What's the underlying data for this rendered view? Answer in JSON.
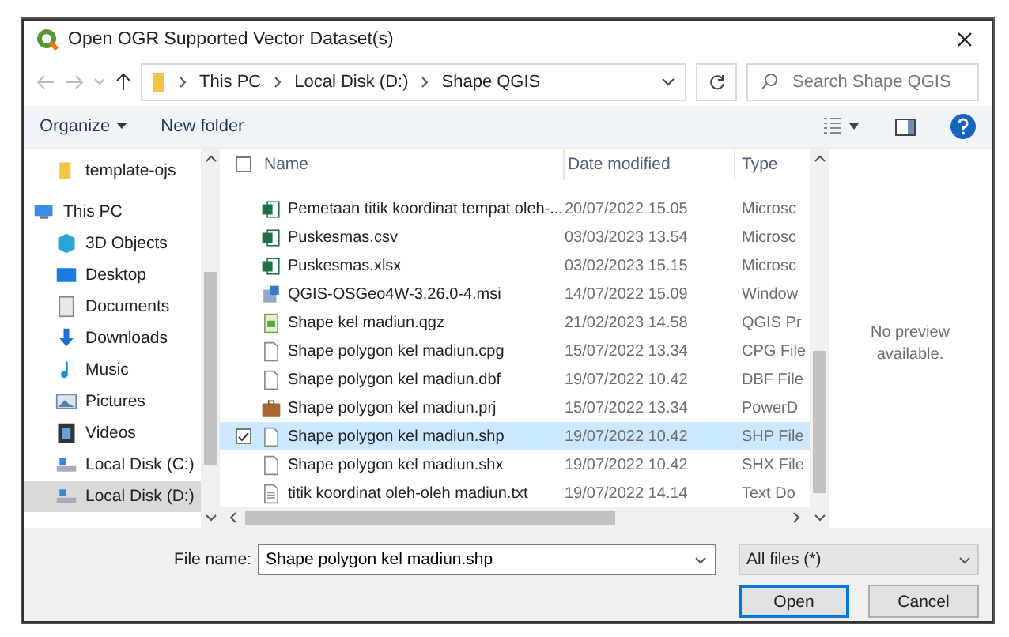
{
  "window": {
    "title": "Open OGR Supported Vector Dataset(s)"
  },
  "address": {
    "breadcrumb": [
      "This PC",
      "Local Disk (D:)",
      "Shape QGIS"
    ],
    "search_placeholder": "Search Shape QGIS"
  },
  "toolbar": {
    "organize": "Organize",
    "new_folder": "New folder"
  },
  "sidebar": {
    "items": [
      {
        "label": "template-ojs",
        "kind": "folder",
        "selected": false
      },
      {
        "label": "This PC",
        "kind": "pc",
        "selected": false
      },
      {
        "label": "3D Objects",
        "kind": "cube",
        "selected": false
      },
      {
        "label": "Desktop",
        "kind": "desktop",
        "selected": false
      },
      {
        "label": "Documents",
        "kind": "docs",
        "selected": false
      },
      {
        "label": "Downloads",
        "kind": "download",
        "selected": false
      },
      {
        "label": "Music",
        "kind": "music",
        "selected": false
      },
      {
        "label": "Pictures",
        "kind": "pictures",
        "selected": false
      },
      {
        "label": "Videos",
        "kind": "videos",
        "selected": false
      },
      {
        "label": "Local Disk (C:)",
        "kind": "drive",
        "selected": false
      },
      {
        "label": "Local Disk (D:)",
        "kind": "drive",
        "selected": true
      }
    ]
  },
  "table": {
    "select_all": {
      "checked": false
    },
    "columns": [
      "Name",
      "Date modified",
      "Type"
    ],
    "rows": [
      {
        "name": "Pemetaan titik koordinat tempat oleh-...",
        "date": "20/07/2022 15.05",
        "type": "Microsc",
        "kind": "excel",
        "selected": false
      },
      {
        "name": "Puskesmas.csv",
        "date": "03/03/2023 13.54",
        "type": "Microsc",
        "kind": "excel",
        "selected": false
      },
      {
        "name": "Puskesmas.xlsx",
        "date": "03/02/2023 15.15",
        "type": "Microsc",
        "kind": "excel",
        "selected": false
      },
      {
        "name": "QGIS-OSGeo4W-3.26.0-4.msi",
        "date": "14/07/2022 15.09",
        "type": "Window",
        "kind": "installer",
        "selected": false
      },
      {
        "name": "Shape kel madiun.qgz",
        "date": "21/02/2023 14.58",
        "type": "QGIS Pr",
        "kind": "qgis",
        "selected": false
      },
      {
        "name": "Shape polygon kel madiun.cpg",
        "date": "15/07/2022 13.34",
        "type": "CPG File",
        "kind": "blank",
        "selected": false
      },
      {
        "name": "Shape polygon kel madiun.dbf",
        "date": "19/07/2022 10.42",
        "type": "DBF File",
        "kind": "blank",
        "selected": false
      },
      {
        "name": "Shape polygon kel madiun.prj",
        "date": "15/07/2022 13.34",
        "type": "PowerD",
        "kind": "briefcase",
        "selected": false
      },
      {
        "name": "Shape polygon kel madiun.shp",
        "date": "19/07/2022 10.42",
        "type": "SHP File",
        "kind": "blank",
        "selected": true
      },
      {
        "name": "Shape polygon kel madiun.shx",
        "date": "19/07/2022 10.42",
        "type": "SHX File",
        "kind": "blank",
        "selected": false
      },
      {
        "name": "titik koordinat oleh-oleh madiun.txt",
        "date": "19/07/2022 14.14",
        "type": "Text Do",
        "kind": "text",
        "selected": false
      }
    ]
  },
  "preview": {
    "message": "No preview available."
  },
  "footer": {
    "file_name_label": "File name:",
    "file_name": "Shape polygon kel madiun.shp",
    "filter": "All files (*)",
    "buttons": [
      "Open",
      "Cancel"
    ]
  }
}
